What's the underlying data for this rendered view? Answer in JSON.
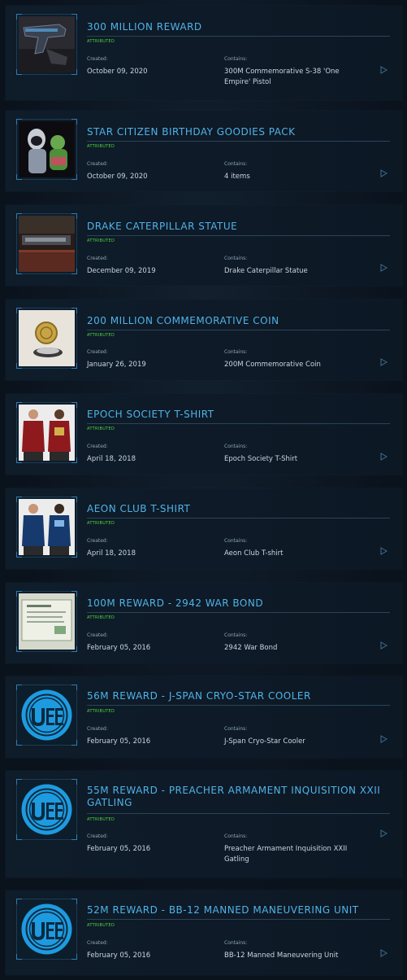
{
  "labels": {
    "created": "Created:",
    "contains": "Contains:"
  },
  "items": [
    {
      "title": "300 MILLION REWARD",
      "status": "ATTRIBUTED",
      "created": "October 09, 2020",
      "contains": "300M Commemorative S-38 'One Empire' Pistol",
      "thumb": "pistol"
    },
    {
      "title": "STAR CITIZEN BIRTHDAY GOODIES PACK",
      "status": "ATTRIBUTED",
      "created": "October 09, 2020",
      "contains": "4 items",
      "thumb": "figures"
    },
    {
      "title": "DRAKE CATERPILLAR STATUE",
      "status": "ATTRIBUTED",
      "created": "December 09, 2019",
      "contains": "Drake Caterpillar Statue",
      "thumb": "statue"
    },
    {
      "title": "200 MILLION COMMEMORATIVE COIN",
      "status": "ATTRIBUTED",
      "created": "January 26, 2019",
      "contains": "200M Commemorative Coin",
      "thumb": "coin"
    },
    {
      "title": "EPOCH SOCIETY T-SHIRT",
      "status": "ATTRIBUTED",
      "created": "April 18, 2018",
      "contains": "Epoch Society T-Shirt",
      "thumb": "shirt-red"
    },
    {
      "title": "AEON CLUB T-SHIRT",
      "status": "ATTRIBUTED",
      "created": "April 18, 2018",
      "contains": "Aeon Club T-shirt",
      "thumb": "shirt-blue"
    },
    {
      "title": "100M REWARD - 2942 WAR BOND",
      "status": "ATTRIBUTED",
      "created": "February 05, 2016",
      "contains": "2942 War Bond",
      "thumb": "bond"
    },
    {
      "title": "56M REWARD - J-SPAN CRYO-STAR COOLER",
      "status": "ATTRIBUTED",
      "created": "February 05, 2016",
      "contains": "J-Span Cryo-Star Cooler",
      "thumb": "uee"
    },
    {
      "title": "55M REWARD - PREACHER ARMAMENT INQUISITION XXII GATLING",
      "status": "ATTRIBUTED",
      "created": "February 05, 2016",
      "contains": "Preacher Armament Inquisition XXII Gatling",
      "thumb": "uee"
    },
    {
      "title": "52M REWARD - BB-12 MANNED MANEUVERING UNIT",
      "status": "ATTRIBUTED",
      "created": "February 05, 2016",
      "contains": "BB-12 Manned Maneuvering Unit",
      "thumb": "uee"
    }
  ],
  "colors": {
    "title": "#4fb3e8",
    "status": "#4fd63b",
    "accent": "#2c7fb0"
  }
}
